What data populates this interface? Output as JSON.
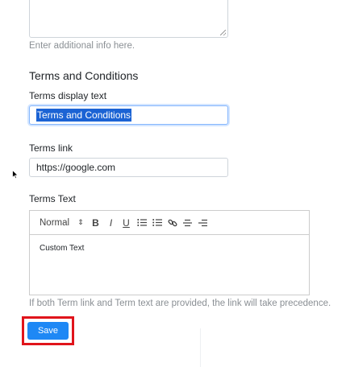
{
  "additional_info": {
    "value": "",
    "help": "Enter additional info here."
  },
  "terms": {
    "section_title": "Terms and Conditions",
    "display_text": {
      "label": "Terms display text",
      "value": "Terms and Conditions"
    },
    "link": {
      "label": "Terms link",
      "value": "https://google.com"
    },
    "text": {
      "label": "Terms Text",
      "toolbar": {
        "format_select": "Normal",
        "buttons": [
          "bold-icon",
          "italic-icon",
          "underline-icon",
          "ordered-list-icon",
          "bullet-list-icon",
          "link-icon",
          "align-center-icon",
          "align-right-icon"
        ],
        "bold_glyph": "B",
        "italic_glyph": "I",
        "underline_glyph": "U"
      },
      "content": "Custom Text",
      "help": "If both Term link and Term text are provided, the link will take precedence."
    }
  },
  "actions": {
    "save_label": "Save"
  },
  "colors": {
    "primary": "#1e88f5",
    "highlight_box": "#e0141b",
    "selection": "#1b63d4"
  }
}
